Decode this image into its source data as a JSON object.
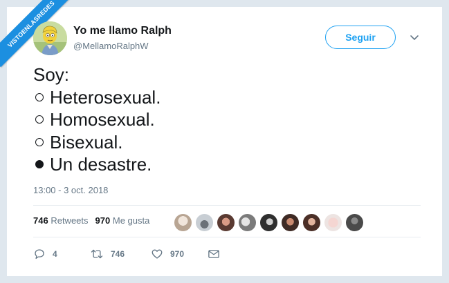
{
  "watermark": "VISTOENLASREDES",
  "tweet": {
    "author_name": "Yo me llamo Ralph",
    "author_handle": "@MellamoRalphW",
    "follow_label": "Seguir",
    "lines": [
      "Soy:",
      "Heterosexual.",
      "Homosexual.",
      "Bisexual.",
      "Un desastre."
    ],
    "timestamp": "13:00 - 3 oct. 2018",
    "retweets_count": "746",
    "retweets_label": "Retweets",
    "likes_count": "970",
    "likes_label": "Me gusta",
    "reply_count": "4",
    "retweet_action_count": "746",
    "like_action_count": "970"
  },
  "colors": {
    "accent": "#1da1f2",
    "frame": "#dfe7ee",
    "banner": "#1c8fe0"
  }
}
